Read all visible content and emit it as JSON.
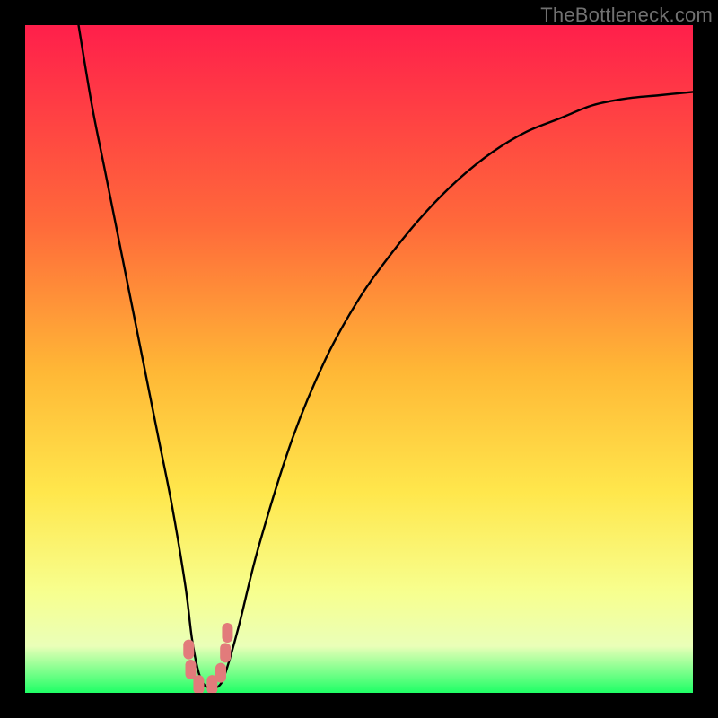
{
  "watermark": "TheBottleneck.com",
  "colors": {
    "bg": "#000000",
    "grad_top": "#ff1f4b",
    "grad_mid1": "#ff6a3a",
    "grad_mid2": "#ffb836",
    "grad_mid3": "#ffe74c",
    "grad_low1": "#f7ff8f",
    "grad_low2": "#eaffb8",
    "grad_bottom": "#1fff66",
    "curve": "#000000",
    "marker": "#e27b7b"
  },
  "chart_data": {
    "type": "line",
    "title": "",
    "xlabel": "",
    "ylabel": "",
    "xlim": [
      0,
      100
    ],
    "ylim": [
      0,
      100
    ],
    "series": [
      {
        "name": "bottleneck-curve",
        "x": [
          8,
          10,
          12,
          14,
          16,
          18,
          20,
          22,
          24,
          25,
          26,
          27,
          28,
          29,
          30,
          32,
          35,
          40,
          45,
          50,
          55,
          60,
          65,
          70,
          75,
          80,
          85,
          90,
          95,
          100
        ],
        "y": [
          100,
          88,
          78,
          68,
          58,
          48,
          38,
          28,
          16,
          8,
          3,
          1,
          1,
          1,
          3,
          10,
          22,
          38,
          50,
          59,
          66,
          72,
          77,
          81,
          84,
          86,
          88,
          89,
          89.5,
          90
        ]
      }
    ],
    "markers": [
      {
        "x": 24.5,
        "y": 6.5
      },
      {
        "x": 24.8,
        "y": 3.5
      },
      {
        "x": 26.0,
        "y": 1.2
      },
      {
        "x": 28.0,
        "y": 1.2
      },
      {
        "x": 29.3,
        "y": 3.0
      },
      {
        "x": 30.0,
        "y": 6.0
      },
      {
        "x": 30.3,
        "y": 9.0
      }
    ]
  }
}
